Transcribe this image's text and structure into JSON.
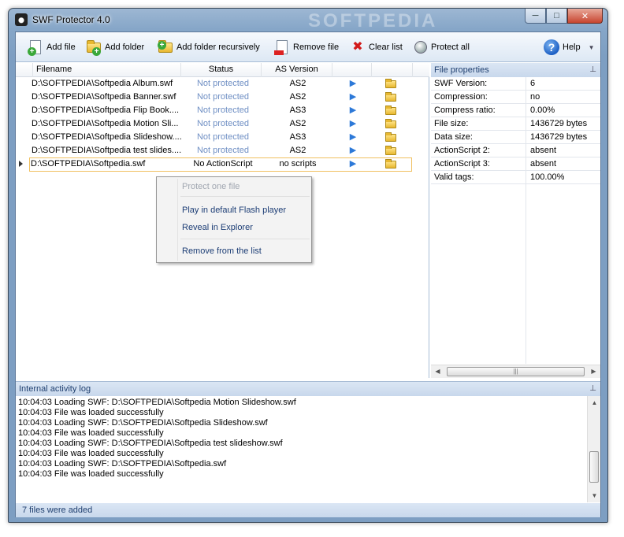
{
  "window": {
    "title": "SWF Protector 4.0",
    "watermark": "SOFTPEDIA",
    "minimize": "─",
    "maximize": "□",
    "close": "✕"
  },
  "toolbar": {
    "add_file": "Add file",
    "add_folder": "Add folder",
    "add_folder_recursively": "Add folder recursively",
    "remove_file": "Remove file",
    "clear_list": "Clear list",
    "protect_all": "Protect all",
    "help": "Help"
  },
  "list": {
    "columns": [
      "Filename",
      "Status",
      "AS Version"
    ],
    "rows": [
      {
        "filename": "D:\\SOFTPEDIA\\Softpedia Album.swf",
        "status": "Not protected",
        "as": "AS2"
      },
      {
        "filename": "D:\\SOFTPEDIA\\Softpedia Banner.swf",
        "status": "Not protected",
        "as": "AS2"
      },
      {
        "filename": "D:\\SOFTPEDIA\\Softpedia Flip Book....",
        "status": "Not protected",
        "as": "AS3"
      },
      {
        "filename": "D:\\SOFTPEDIA\\Softpedia Motion Sli...",
        "status": "Not protected",
        "as": "AS2"
      },
      {
        "filename": "D:\\SOFTPEDIA\\Softpedia Slideshow....",
        "status": "Not protected",
        "as": "AS3"
      },
      {
        "filename": "D:\\SOFTPEDIA\\Softpedia test slides....",
        "status": "Not protected",
        "as": "AS2"
      },
      {
        "filename": "D:\\SOFTPEDIA\\Softpedia.swf",
        "status": "No ActionScript",
        "as": "no scripts"
      }
    ]
  },
  "context_menu": {
    "protect_one": "Protect one file",
    "play": "Play in default Flash player",
    "reveal": "Reveal in Explorer",
    "remove": "Remove from the list"
  },
  "properties": {
    "title": "File properties",
    "items": [
      {
        "key": "SWF Version:",
        "value": "6"
      },
      {
        "key": "Compression:",
        "value": "no"
      },
      {
        "key": "Compress ratio:",
        "value": "0.00%"
      },
      {
        "key": "File size:",
        "value": "1436729 bytes"
      },
      {
        "key": "Data size:",
        "value": "1436729 bytes"
      },
      {
        "key": "ActionScript 2:",
        "value": "absent"
      },
      {
        "key": "ActionScript 3:",
        "value": "absent"
      },
      {
        "key": "Valid tags:",
        "value": "100.00%"
      }
    ]
  },
  "log": {
    "title": "Internal activity log",
    "lines": [
      "10:04:03 Loading SWF: D:\\SOFTPEDIA\\Softpedia Motion Slideshow.swf",
      "10:04:03 File was loaded successfully",
      "10:04:03 Loading SWF: D:\\SOFTPEDIA\\Softpedia Slideshow.swf",
      "10:04:03 File was loaded successfully",
      "10:04:03 Loading SWF: D:\\SOFTPEDIA\\Softpedia test slideshow.swf",
      "10:04:03 File was loaded successfully",
      "10:04:03 Loading SWF: D:\\SOFTPEDIA\\Softpedia.swf",
      "10:04:03 File was loaded successfully"
    ]
  },
  "status": {
    "text": "7 files were added"
  }
}
